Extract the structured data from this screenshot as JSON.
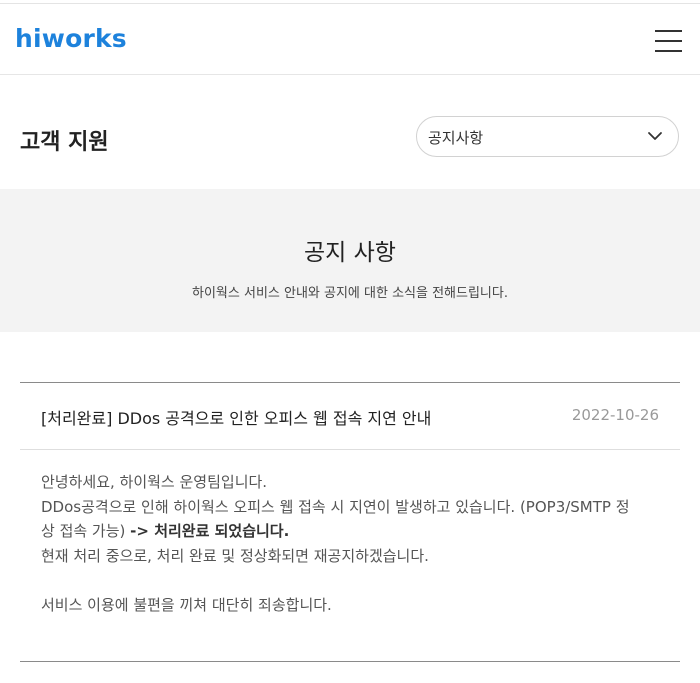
{
  "header": {
    "logo": "hiworks",
    "menu_icon": "hamburger-menu-icon"
  },
  "page": {
    "title": "고객 지원"
  },
  "category_select": {
    "value": "공지사항",
    "icon": "chevron-down-icon"
  },
  "banner": {
    "title": "공지 사항",
    "subtitle": "하이웍스 서비스 안내와 공지에 대한 소식을 전해드립니다."
  },
  "notice": {
    "title": "[처리완료] DDos 공격으로 인한 오피스 웹 접속 지연 안내",
    "date": "2022-10-26",
    "body": {
      "line1": "안녕하세요, 하이웍스 운영팀입니다.",
      "line2": "DDos공격으로 인해 하이웍스 오피스 웹  접속 시 지연이 발생하고 있습니다. (POP3/SMTP 정",
      "line3_prefix": "상 접속 가능) ",
      "line3_bold": "-> 처리완료 되었습니다.",
      "line4": "현재 처리 중으로, 처리 완료 및 정상화되면 재공지하겠습니다.",
      "line5": "서비스 이용에 불편을 끼쳐 대단히 죄송합니다."
    }
  },
  "colors": {
    "brand": "#1d82dc",
    "banner_bg": "#f3f3f3",
    "date_text": "#999999"
  }
}
